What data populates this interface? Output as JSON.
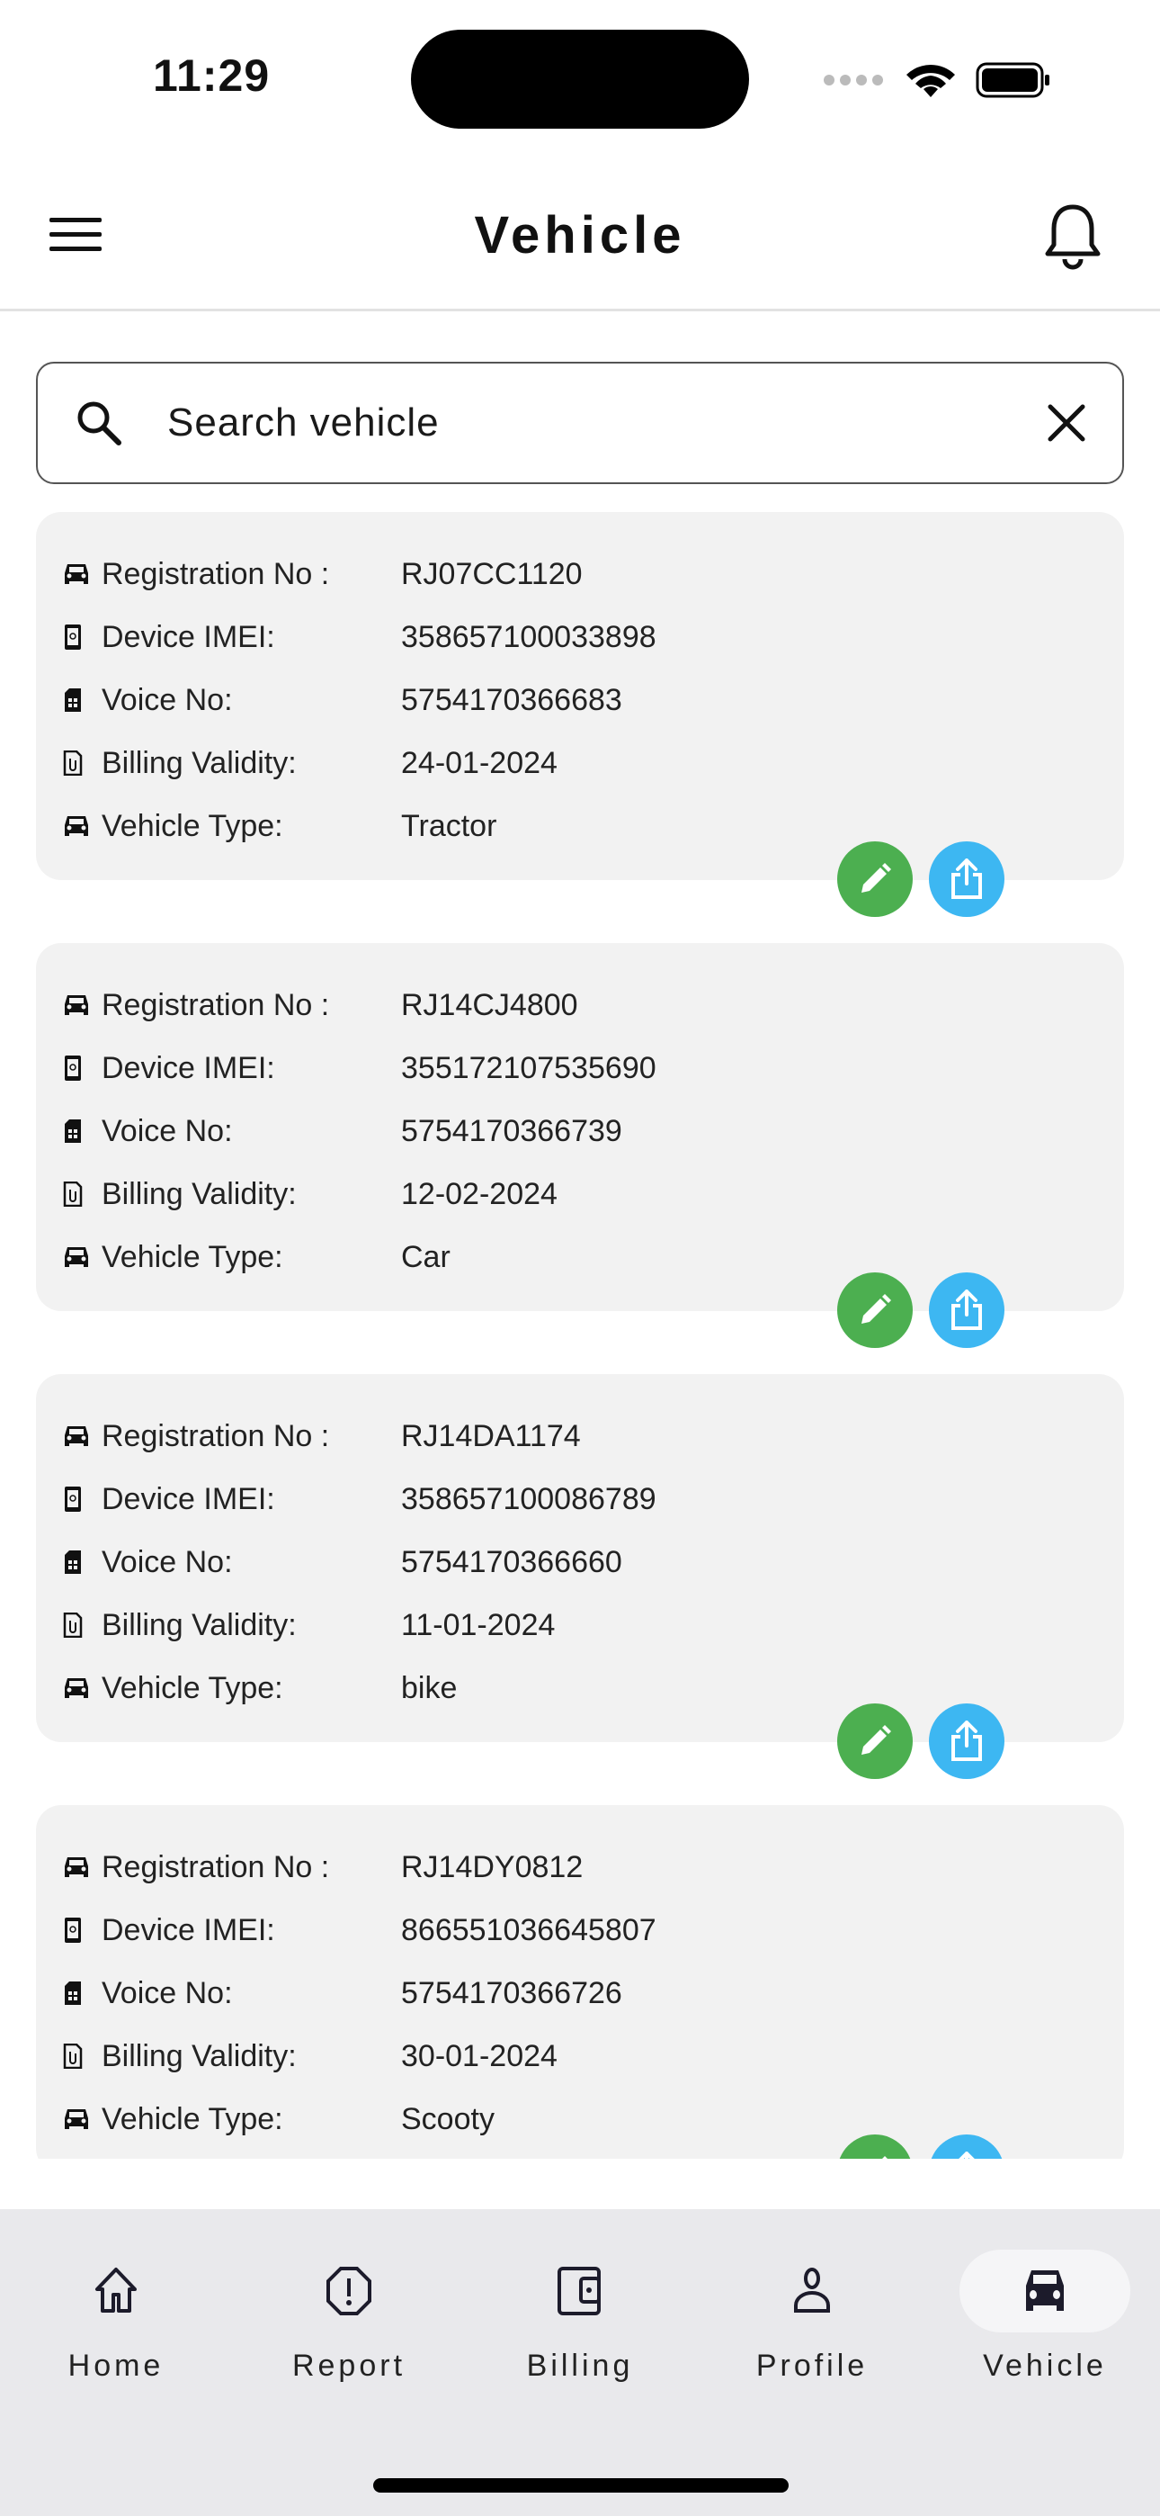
{
  "status_bar": {
    "time": "11:29"
  },
  "header": {
    "title": "Vehicle"
  },
  "search": {
    "placeholder": "Search vehicle"
  },
  "labels": {
    "registration": "Registration No :",
    "imei": "Device IMEI:",
    "voice": "Voice No:",
    "billing": "Billing Validity:",
    "type": "Vehicle Type:"
  },
  "vehicles": [
    {
      "registration": "RJ07CC1120",
      "imei": "358657100033898",
      "voice": "5754170366683",
      "billing": "24-01-2024",
      "type": "Tractor"
    },
    {
      "registration": "RJ14CJ4800",
      "imei": "355172107535690",
      "voice": "5754170366739",
      "billing": "12-02-2024",
      "type": "Car"
    },
    {
      "registration": "RJ14DA1174",
      "imei": "358657100086789",
      "voice": "5754170366660",
      "billing": "11-01-2024",
      "type": "bike"
    },
    {
      "registration": "RJ14DY0812",
      "imei": "866551036645807",
      "voice": "5754170366726",
      "billing": "30-01-2024",
      "type": "Scooty"
    }
  ],
  "colors": {
    "edit": "#4caf50",
    "share": "#3db7f2",
    "nav_bg": "#e9e9ec",
    "card_bg": "#f2f2f2"
  },
  "nav": [
    {
      "label": "Home",
      "icon": "home-icon"
    },
    {
      "label": "Report",
      "icon": "report-icon"
    },
    {
      "label": "Billing",
      "icon": "wallet-icon"
    },
    {
      "label": "Profile",
      "icon": "person-icon"
    },
    {
      "label": "Vehicle",
      "icon": "car-icon",
      "active": true
    }
  ]
}
